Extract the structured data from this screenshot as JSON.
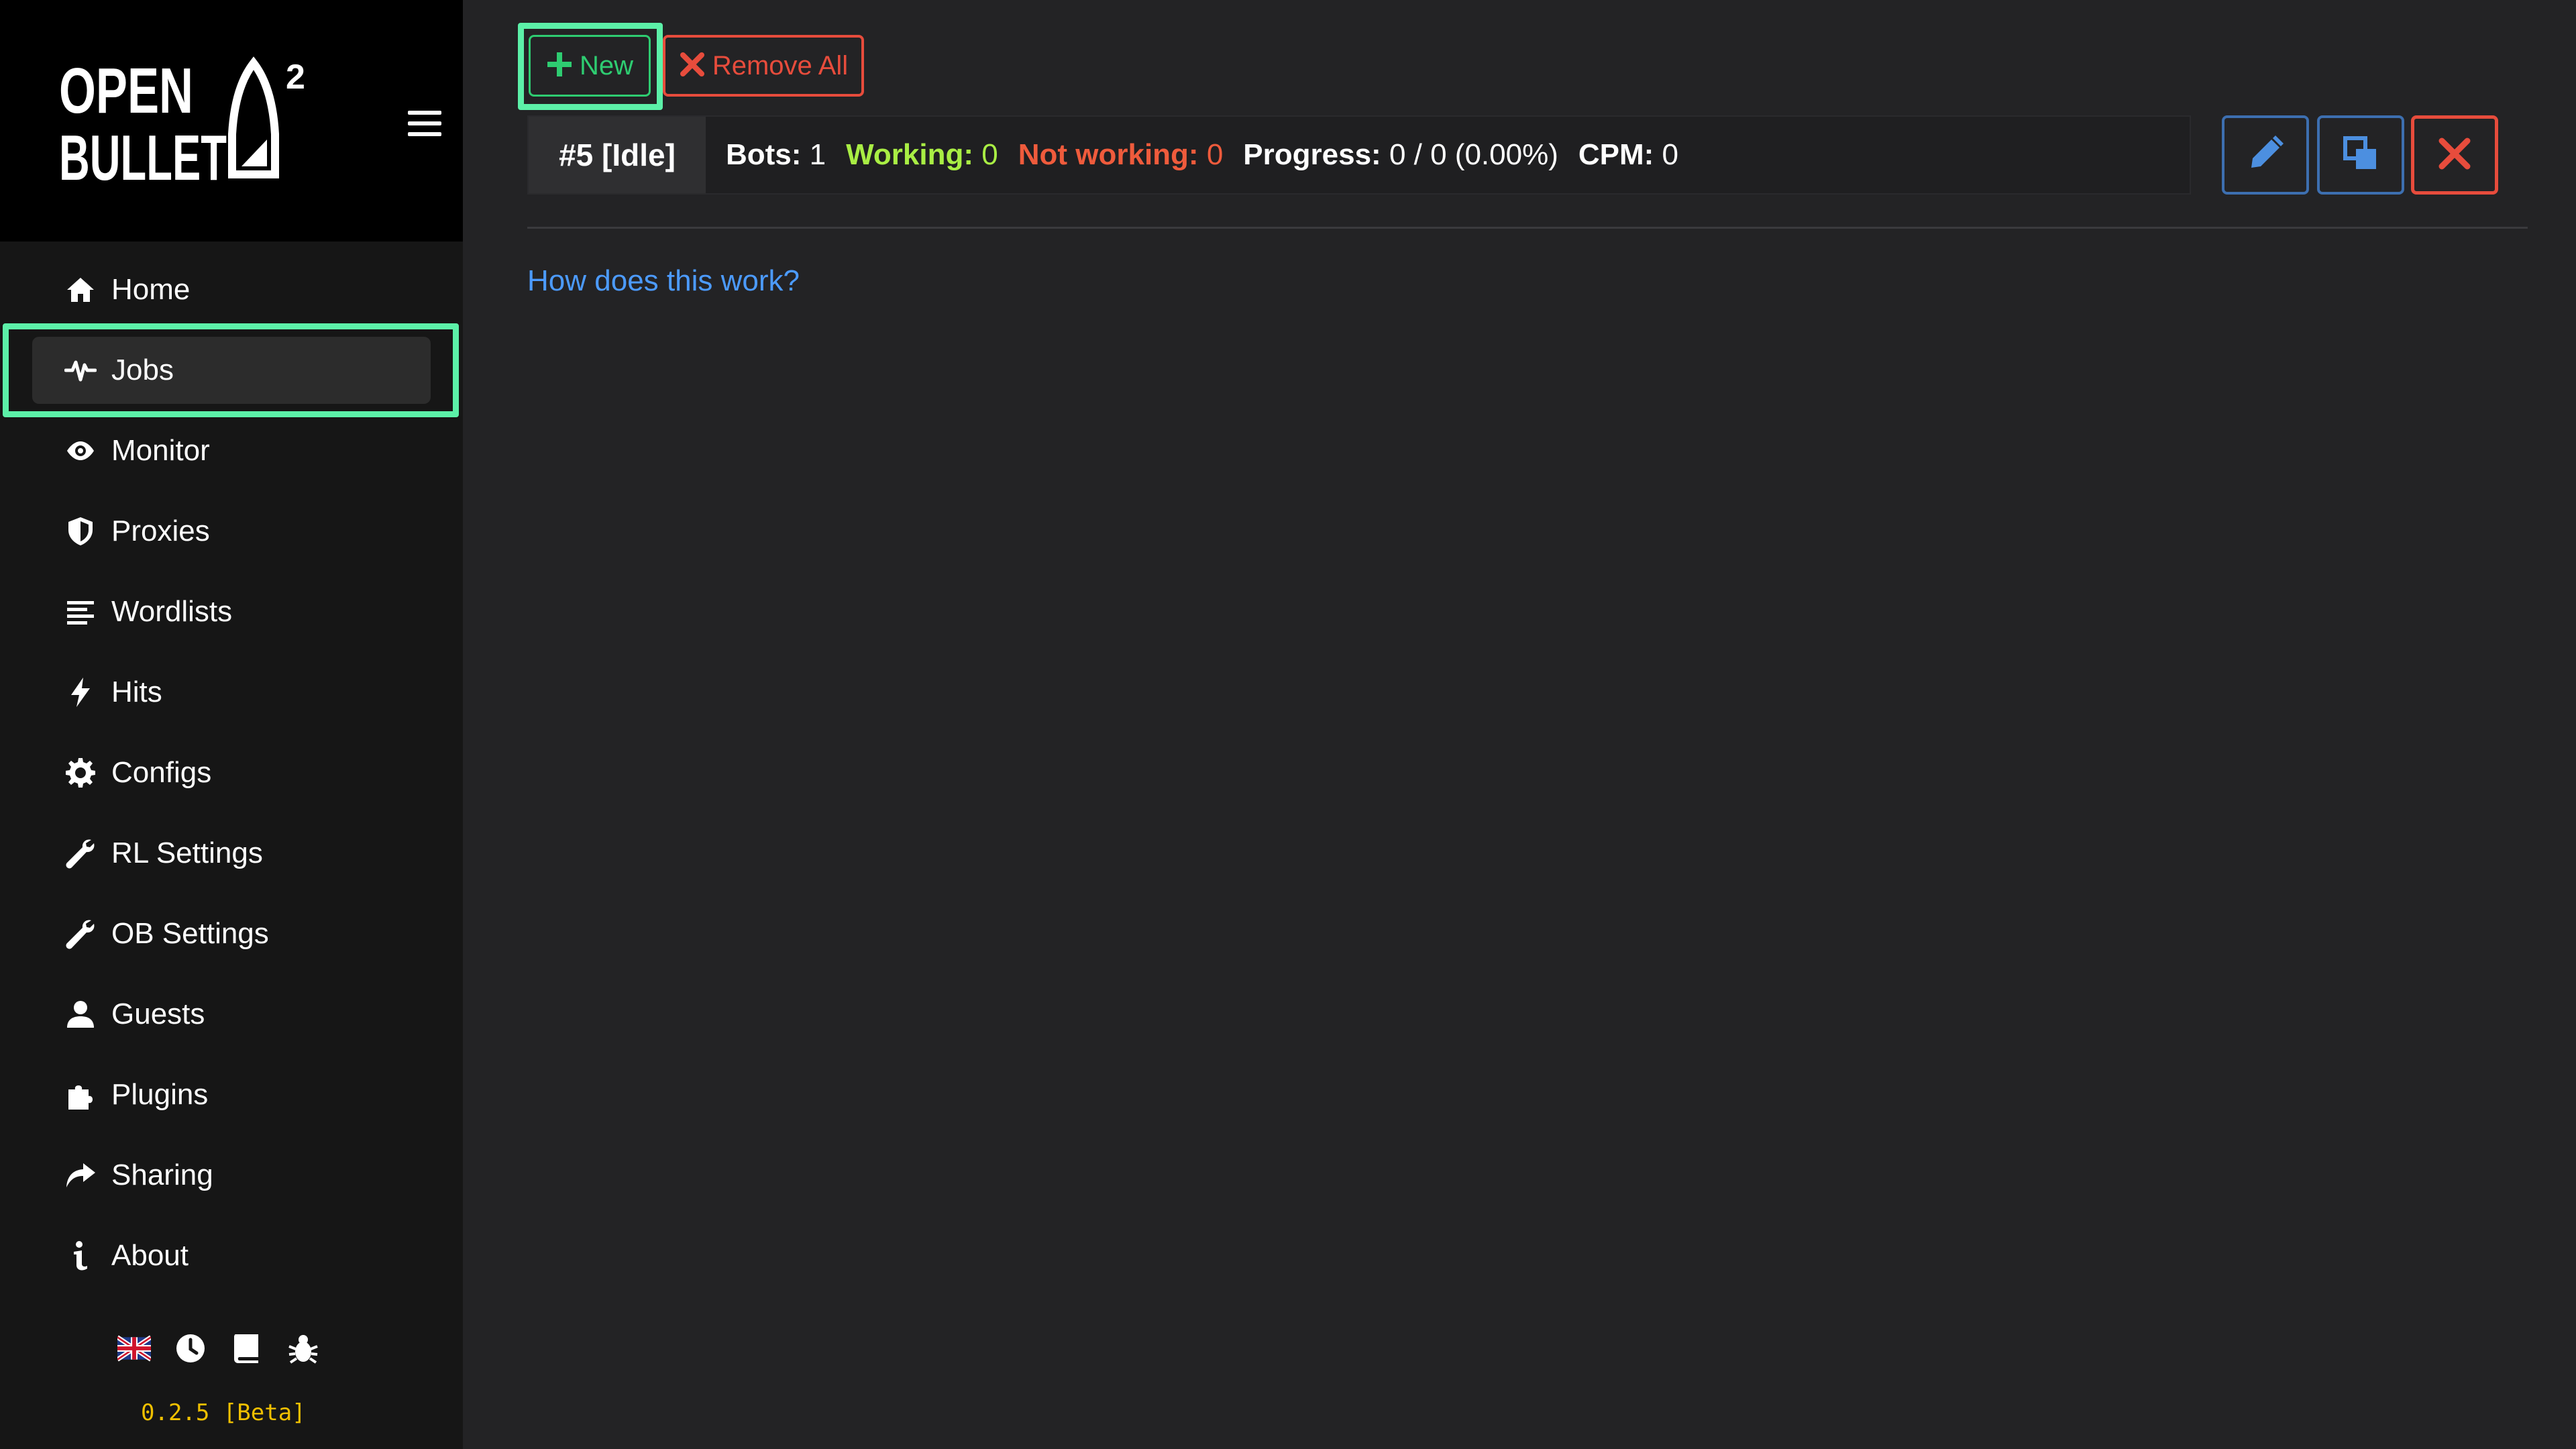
{
  "brand": {
    "logo_line1": "OPEN",
    "logo_line2": "BULLET",
    "logo_sup": "2"
  },
  "sidebar": {
    "active": "Jobs",
    "items": [
      {
        "label": "Home",
        "icon": "home-icon"
      },
      {
        "label": "Jobs",
        "icon": "activity-icon"
      },
      {
        "label": "Monitor",
        "icon": "eye-icon"
      },
      {
        "label": "Proxies",
        "icon": "shield-icon"
      },
      {
        "label": "Wordlists",
        "icon": "list-icon"
      },
      {
        "label": "Hits",
        "icon": "bolt-icon"
      },
      {
        "label": "Configs",
        "icon": "gear-icon"
      },
      {
        "label": "RL Settings",
        "icon": "wrench-icon"
      },
      {
        "label": "OB Settings",
        "icon": "wrench-icon"
      },
      {
        "label": "Guests",
        "icon": "user-icon"
      },
      {
        "label": "Plugins",
        "icon": "puzzle-icon"
      },
      {
        "label": "Sharing",
        "icon": "share-icon"
      },
      {
        "label": "About",
        "icon": "info-icon"
      }
    ],
    "footer_icons": [
      "uk-flag-icon",
      "clock-icon",
      "book-icon",
      "bug-icon"
    ],
    "version": "0.2.5 [Beta]"
  },
  "toolbar": {
    "new_label": "New",
    "remove_all_label": "Remove All"
  },
  "job": {
    "id_label": "#5 [Idle]",
    "bots_label": "Bots:",
    "bots_value": "1",
    "working_label": "Working:",
    "working_value": "0",
    "not_working_label": "Not working:",
    "not_working_value": "0",
    "progress_label": "Progress:",
    "progress_value": "0 / 0 (0.00%)",
    "cpm_label": "CPM:",
    "cpm_value": "0"
  },
  "help_link": "How does this work?",
  "colors": {
    "background": "#232325",
    "sidebar": "#161616",
    "highlight": "#5cf0a8",
    "green": "#2ecc71",
    "red": "#e74c3c",
    "link": "#4c9bff",
    "version": "#f0c000"
  }
}
